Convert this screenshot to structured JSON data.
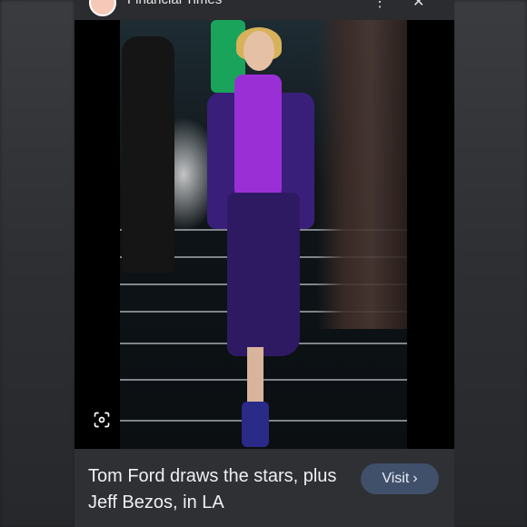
{
  "header": {
    "source_name": "Financial Times",
    "icons": [
      "share-icon",
      "close-icon"
    ]
  },
  "image": {
    "lens_icon": "lens-search-icon"
  },
  "result": {
    "caption": "Tom Ford draws the stars, plus Jeff Bezos, in LA",
    "visit_label": "Visit",
    "visit_chevron": "›"
  },
  "colors": {
    "card_bg": "#2f3033",
    "visit_bg": "#40506a",
    "caption_text": "#eef0f2"
  }
}
